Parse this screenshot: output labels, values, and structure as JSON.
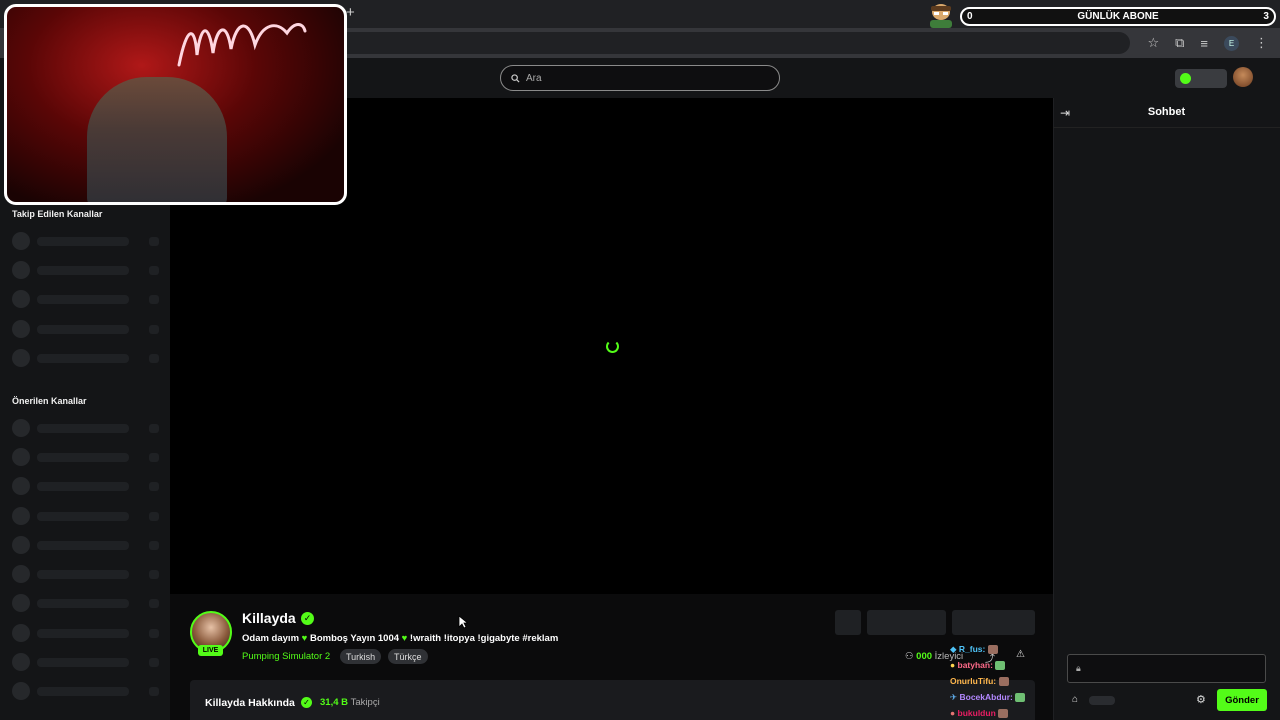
{
  "browser": {
    "new_tab_icon": "+",
    "window_controls": [
      "—",
      "▢",
      "✕"
    ],
    "profile_initial": "E"
  },
  "overlay_subs": {
    "count_left": "0",
    "label": "GÜNLÜK ABONE",
    "count_right": "3"
  },
  "header": {
    "search_placeholder": "Ara"
  },
  "sidebar": {
    "followed_title": "Takip Edilen Kanallar",
    "recommended_title": "Önerilen Kanallar"
  },
  "stream": {
    "streamer": "Killayda",
    "live_label": "LIVE",
    "title_part1": "Odam dayım ",
    "title_part2": " Bomboş Yayın 1004 ",
    "title_part3": " !wraith !itopya !gigabyte #reklam",
    "category": "Pumping Simulator 2",
    "tags": [
      "Turkish",
      "Türkçe"
    ],
    "viewers_value": "000",
    "viewers_label": "İzleyici"
  },
  "about": {
    "title": "Killayda Hakkında",
    "followers_value": "31,4 B",
    "followers_label": "Takipçi"
  },
  "chat_overlay": [
    {
      "name": "R_fus:",
      "color": "#4fc3f7"
    },
    {
      "name": "batyhan:",
      "color": "#ff6b8a"
    },
    {
      "name": "OnurluTifu:",
      "color": "#ffb74d"
    },
    {
      "name": "BocekAbdur:",
      "color": "#b388ff"
    },
    {
      "name": "bukuldun",
      "color": "#e91e63"
    }
  ],
  "chat": {
    "title": "Sohbet",
    "send_label": "Gönder"
  },
  "colors": {
    "accent": "#53fc18",
    "background": "#0b0b0c",
    "panel": "#141517"
  }
}
